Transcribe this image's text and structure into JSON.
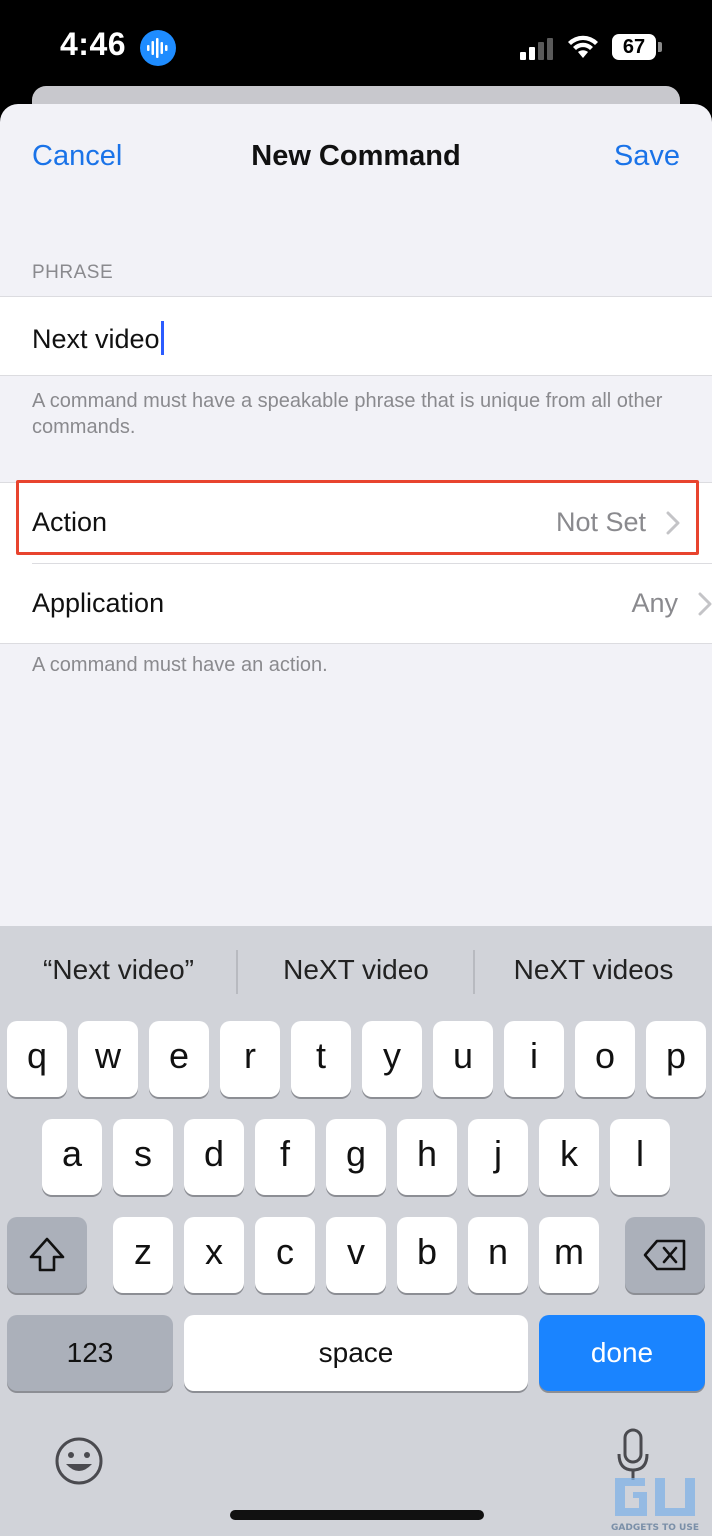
{
  "status": {
    "time": "4:46",
    "battery": "67"
  },
  "nav": {
    "cancel": "Cancel",
    "title": "New Command",
    "save": "Save"
  },
  "phrase": {
    "header": "PHRASE",
    "value": "Next video",
    "footer": "A command must have a speakable phrase that is unique from all other commands."
  },
  "rows": [
    {
      "label": "Action",
      "value": "Not Set"
    },
    {
      "label": "Application",
      "value": "Any"
    }
  ],
  "rows_footer": "A command must have an action.",
  "keyboard": {
    "suggestions": [
      "“Next video”",
      "NeXT video",
      "NeXT videos"
    ],
    "row1": [
      "q",
      "w",
      "e",
      "r",
      "t",
      "y",
      "u",
      "i",
      "o",
      "p"
    ],
    "row2": [
      "a",
      "s",
      "d",
      "f",
      "g",
      "h",
      "j",
      "k",
      "l"
    ],
    "row3": [
      "z",
      "x",
      "c",
      "v",
      "b",
      "n",
      "m"
    ],
    "numbers": "123",
    "space": "space",
    "done": "done"
  },
  "watermark": "GADGETS TO USE",
  "colors": {
    "accent": "#1a73e8",
    "highlight": "#e8442e",
    "done_key": "#1a84ff"
  }
}
